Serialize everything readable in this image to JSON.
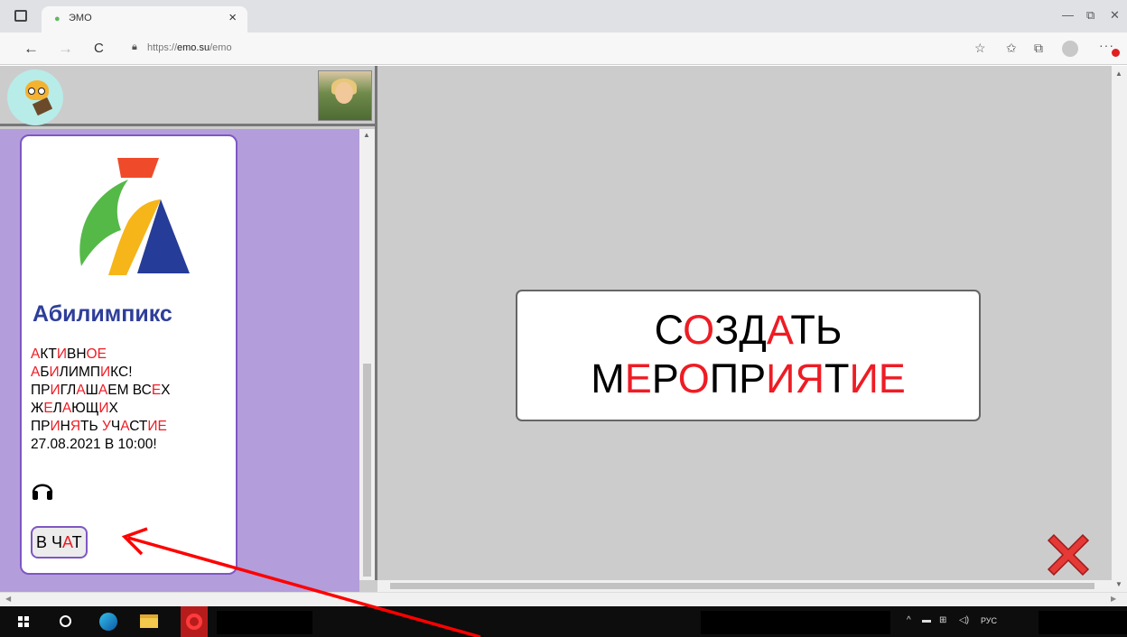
{
  "browser": {
    "tab_title": "ЭМО",
    "tab_favicon": "bird-favicon-icon",
    "url_prefix": "https://",
    "url_domain": "emo.su",
    "url_path": "/emo",
    "close_tab_symbol": "×",
    "back_symbol": "←",
    "forward_symbol": "→",
    "reload_symbol": "C",
    "minimize_symbol": "—",
    "restore_symbol": "⧉",
    "close_symbol": "✕"
  },
  "event": {
    "org_name": "Абилимпикс",
    "lines": [
      [
        [
          "А",
          "r"
        ],
        [
          "КТ",
          ""
        ],
        [
          "И",
          "r"
        ],
        [
          "ВН",
          ""
        ],
        [
          "ОЕ",
          "r"
        ]
      ],
      [
        [
          "А",
          "r"
        ],
        [
          "Б",
          ""
        ],
        [
          "И",
          "r"
        ],
        [
          "ЛИМП",
          ""
        ],
        [
          "И",
          "r"
        ],
        [
          "КС!",
          ""
        ]
      ],
      [
        [
          "ПР",
          ""
        ],
        [
          "И",
          "r"
        ],
        [
          "ГЛ",
          ""
        ],
        [
          "А",
          "r"
        ],
        [
          "Ш",
          ""
        ],
        [
          "А",
          "r"
        ],
        [
          "ЕМ ВС",
          ""
        ],
        [
          "Е",
          "r"
        ],
        [
          "Х",
          ""
        ]
      ],
      [
        [
          "Ж",
          ""
        ],
        [
          "Е",
          "r"
        ],
        [
          "Л",
          ""
        ],
        [
          "А",
          "r"
        ],
        [
          "Ю",
          ""
        ],
        [
          "Щ",
          ""
        ],
        [
          "И",
          "r"
        ],
        [
          "Х",
          ""
        ]
      ],
      [
        [
          "ПР",
          ""
        ],
        [
          "И",
          "r"
        ],
        [
          "Н",
          ""
        ],
        [
          "Я",
          "r"
        ],
        [
          "ТЬ ",
          ""
        ],
        [
          "У",
          "r"
        ],
        [
          "Ч",
          ""
        ],
        [
          "А",
          "r"
        ],
        [
          "СТ",
          ""
        ],
        [
          "И",
          "r"
        ],
        [
          "Е",
          "r"
        ]
      ]
    ],
    "datetime": "27.08.2021 В 10:00!",
    "chat_button": [
      [
        "В Ч",
        ""
      ],
      [
        "А",
        "r"
      ],
      [
        "Т",
        ""
      ]
    ]
  },
  "main": {
    "create_button_line1": [
      [
        "С",
        ""
      ],
      [
        "О",
        "r"
      ],
      [
        "ЗД",
        ""
      ],
      [
        "А",
        "r"
      ],
      [
        "ТЬ",
        ""
      ]
    ],
    "create_button_line2": [
      [
        "М",
        ""
      ],
      [
        "Е",
        "r"
      ],
      [
        "Р",
        ""
      ],
      [
        "О",
        "r"
      ],
      [
        "ПР",
        ""
      ],
      [
        "И",
        "r"
      ],
      [
        "Я",
        "r"
      ],
      [
        "Т",
        ""
      ],
      [
        "И",
        "r"
      ],
      [
        "Е",
        "r"
      ]
    ]
  },
  "taskbar": {
    "language": "РУС"
  },
  "colors": {
    "accent_red": "#ee1c24",
    "panel_purple": "#b39ddb",
    "border_purple": "#7e57c2",
    "page_gray": "#cccccc",
    "brand_blue": "#2e3e9a"
  }
}
